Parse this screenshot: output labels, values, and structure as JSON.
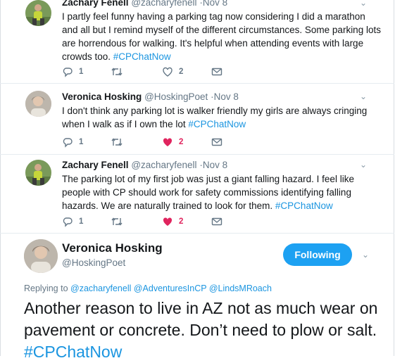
{
  "colors": {
    "link": "#1b95e0",
    "like": "#e0245e",
    "button": "#1da1f2",
    "muted": "#657786"
  },
  "replies": [
    {
      "name": "Zachary Fenell",
      "handle": "@zacharyfenell",
      "time": "·Nov 8",
      "avatar_icon": "person-outdoors-avatar",
      "text": "I partly feel funny having a parking tag now considering I did a marathon and all but I remind myself of the different circumstances. Some parking lots are horrendous for walking. It's helpful when attending events with large crowds too.",
      "hashtag": "#CPChatNow",
      "reply_count": "1",
      "retweet_count": "",
      "like_count": "2",
      "liked": false
    },
    {
      "name": "Veronica Hosking",
      "handle": "@HoskingPoet",
      "time": "·Nov 8",
      "avatar_icon": "person-portrait-avatar",
      "text": "I don't think any parking lot is walker friendly my girls are always cringing when I walk as if I own the lot",
      "hashtag": "#CPChatNow",
      "reply_count": "1",
      "retweet_count": "",
      "like_count": "2",
      "liked": true
    },
    {
      "name": "Zachary Fenell",
      "handle": "@zacharyfenell",
      "time": "·Nov 8",
      "avatar_icon": "person-outdoors-avatar",
      "text": "The parking lot of my first job was just a giant falling hazard. I feel like people with CP should work for safety commissions identifying falling hazards. We are naturally trained to look for them.",
      "hashtag": "#CPChatNow",
      "reply_count": "1",
      "retweet_count": "",
      "like_count": "2",
      "liked": true
    }
  ],
  "main": {
    "name": "Veronica Hosking",
    "handle": "@HoskingPoet",
    "follow_label": "Following",
    "replying_prefix": "Replying to",
    "replying_to": [
      "@zacharyfenell",
      "@AdventuresInCP",
      "@LindsMRoach"
    ],
    "text": "Another reason to live in AZ not as much wear on pavement or concrete. Don’t need to plow or salt.",
    "hashtag": "#CPChatNow"
  }
}
